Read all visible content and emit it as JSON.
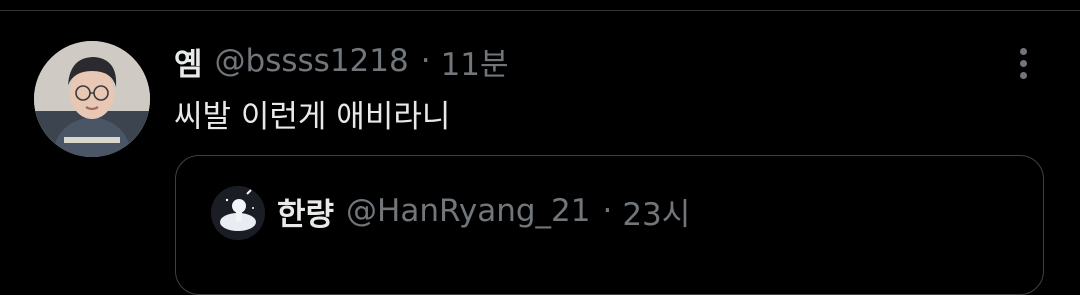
{
  "tweet": {
    "display_name": "옘",
    "handle": "@bssss1218",
    "separator": "·",
    "time": "11분",
    "text": "씨발 이런게 애비라니",
    "avatar_icon": "profile-photo",
    "more_icon": "more-vertical-icon"
  },
  "quoted": {
    "display_name": "한량",
    "handle": "@HanRyang_21",
    "separator": "·",
    "time": "23시",
    "avatar_icon": "astronaut-avatar"
  },
  "colors": {
    "background": "#000000",
    "primary_text": "#e7e9ea",
    "secondary_text": "#71767b",
    "border": "#2f3336"
  }
}
